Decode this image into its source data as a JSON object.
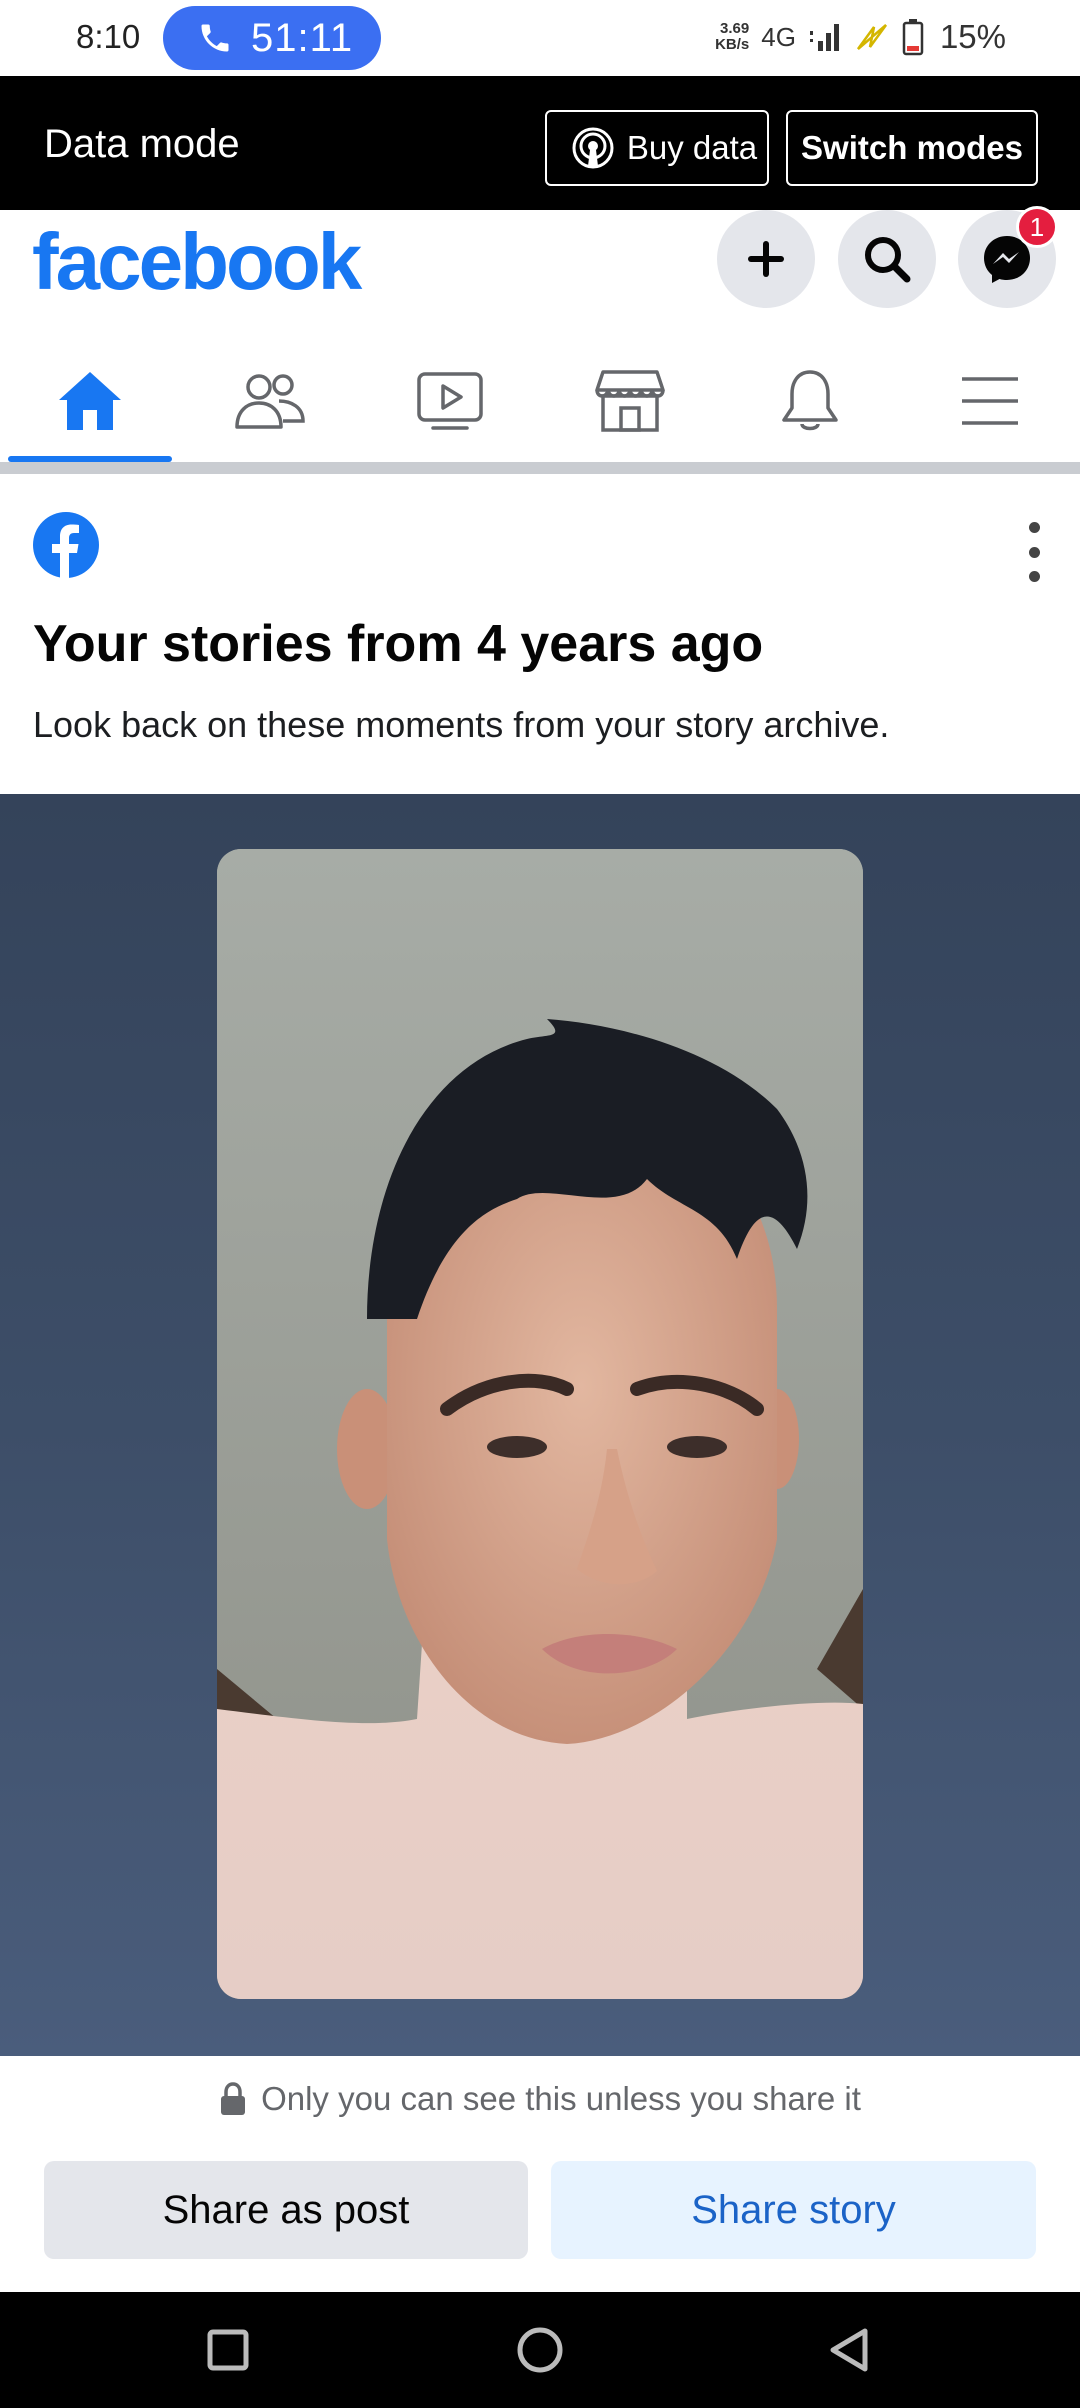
{
  "status_bar": {
    "time": "8:10",
    "call_timer": "51:11",
    "net_speed_value": "3.69",
    "net_speed_unit": "KB/s",
    "network": "4G",
    "battery": "15%"
  },
  "data_mode": {
    "title": "Data mode",
    "buy_label": "Buy data",
    "switch_label": "Switch modes"
  },
  "header": {
    "logo": "facebook",
    "messenger_badge": "1",
    "brand_color": "#1877f2"
  },
  "nav": {
    "items": [
      {
        "name": "home",
        "icon": "home-icon",
        "active": true
      },
      {
        "name": "friends",
        "icon": "friends-icon",
        "active": false
      },
      {
        "name": "watch",
        "icon": "video-icon",
        "active": false
      },
      {
        "name": "marketplace",
        "icon": "store-icon",
        "active": false
      },
      {
        "name": "notifications",
        "icon": "bell-icon",
        "active": false
      },
      {
        "name": "menu",
        "icon": "hamburger-icon",
        "active": false
      }
    ]
  },
  "memory": {
    "title": "Your stories from 4 years ago",
    "subtitle": "Look back on these moments from your story archive."
  },
  "story": {
    "image": "selfie-photo"
  },
  "actions": {
    "privacy_text": "Only you can see this unless you share it",
    "share_post": "Share as post",
    "share_story": "Share story"
  }
}
